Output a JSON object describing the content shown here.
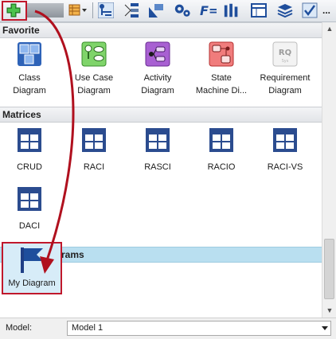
{
  "toolbar": {
    "add_icon": "plus-icon",
    "more_label": "..."
  },
  "sections": {
    "favorite": {
      "title": "Favorite",
      "items": [
        {
          "label1": "Class",
          "label2": "Diagram",
          "icon": "class-diagram-icon"
        },
        {
          "label1": "Use Case",
          "label2": "Diagram",
          "icon": "use-case-diagram-icon"
        },
        {
          "label1": "Activity",
          "label2": "Diagram",
          "icon": "activity-diagram-icon"
        },
        {
          "label1": "State",
          "label2": "Machine Di...",
          "icon": "state-machine-diagram-icon"
        },
        {
          "label1": "Requirement",
          "label2": "Diagram",
          "icon": "requirement-diagram-icon"
        }
      ]
    },
    "matrices": {
      "title": "Matrices",
      "items": [
        {
          "label": "CRUD"
        },
        {
          "label": "RACI"
        },
        {
          "label": "RASCI"
        },
        {
          "label": "RACIO"
        },
        {
          "label": "RACI-VS"
        },
        {
          "label": "DACI"
        }
      ]
    },
    "custom": {
      "title": "Custom Diagrams",
      "items": [
        {
          "label": "My Diagram",
          "icon": "flag-icon"
        }
      ]
    }
  },
  "model": {
    "label": "Model:",
    "value": "Model 1"
  },
  "colors": {
    "highlight": "#c0182c",
    "custom_header": "#b9dff0",
    "matrix_blue": "#2b4c8f"
  }
}
